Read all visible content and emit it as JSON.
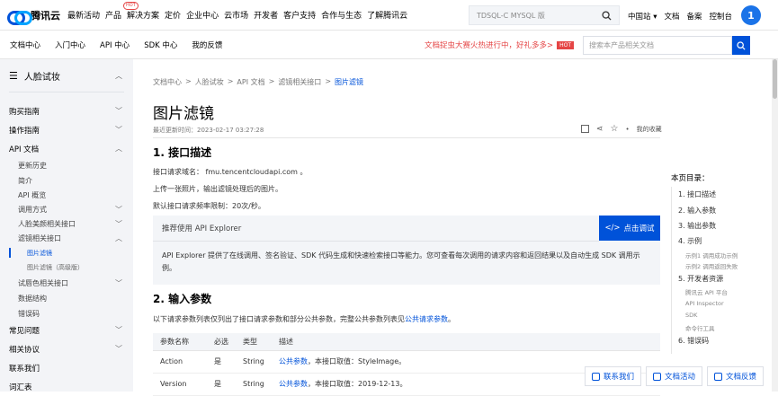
{
  "topbar": {
    "brand": "腾讯云",
    "nav": [
      "最新活动",
      "产品",
      "解决方案",
      "定价",
      "企业中心",
      "云市场",
      "开发者",
      "客户支持",
      "合作与生态",
      "了解腾讯云"
    ],
    "hot_badge": "HOT",
    "search_placeholder": "TDSQL-C MYSQL 版",
    "right_links": [
      "中国站",
      "文档",
      "备案",
      "控制台"
    ],
    "avatar_text": "1"
  },
  "subbar": {
    "links": [
      "文档中心",
      "入门中心",
      "API 中心",
      "SDK 中心",
      "我的反馈"
    ],
    "promo_text": "文档捉虫大赛火热进行中，好礼多多>",
    "promo_badge": "HOT",
    "doc_search_placeholder": "搜索本产品相关文档"
  },
  "sidebar": {
    "product": "人脸试妆",
    "items": [
      {
        "label": "购买指南"
      },
      {
        "label": "操作指南"
      },
      {
        "label": "API 文档"
      },
      {
        "label": "更新历史"
      },
      {
        "label": "简介"
      },
      {
        "label": "API 概览"
      },
      {
        "label": "调用方式"
      },
      {
        "label": "人脸美颜相关接口"
      },
      {
        "label": "滤镜相关接口"
      },
      {
        "label": "图片滤镜"
      },
      {
        "label": "图片滤镜（高级版）"
      },
      {
        "label": "试唇色相关接口"
      },
      {
        "label": "数据结构"
      },
      {
        "label": "错误码"
      },
      {
        "label": "常见问题"
      },
      {
        "label": "相关协议"
      },
      {
        "label": "联系我们"
      },
      {
        "label": "词汇表"
      }
    ]
  },
  "breadcrumb": [
    "文档中心",
    ">",
    "人脸试妆",
    ">",
    "API 文档",
    ">",
    "滤镜相关接口",
    ">",
    "图片滤镜"
  ],
  "page": {
    "title": "图片滤镜",
    "updated": "最近更新时间：2023-02-17 03:27:28",
    "favorite": "我的收藏",
    "h_desc": "1. 接口描述",
    "domain_line": "接口请求域名： fmu.tencentcloudapi.com 。",
    "desc_line": "上传一张照片，输出滤镜处理后的图片。",
    "rate_line": "默认接口请求频率限制：20次/秒。",
    "api_explorer_title": "推荐使用 API Explorer",
    "api_explorer_button": "点击调试",
    "api_explorer_text": "API Explorer 提供了在线调用、签名验证、SDK 代码生成和快速检索接口等能力。您可查看每次调用的请求内容和返回结果以及自动生成 SDK 调用示例。",
    "h_params": "2. 输入参数",
    "params_intro": "以下请求参数列表仅列出了接口请求参数和部分公共参数，完整公共参数列表见",
    "params_link": "公共请求参数",
    "params_intro_end": "。",
    "table": {
      "headers": [
        "参数名称",
        "必选",
        "类型",
        "描述"
      ],
      "rows": [
        {
          "name": "Action",
          "required": "是",
          "type": "String",
          "link": "公共参数",
          "desc": "，本接口取值：StyleImage。"
        },
        {
          "name": "Version",
          "required": "是",
          "type": "String",
          "link": "公共参数",
          "desc": "，本接口取值：2019-12-13。"
        }
      ]
    }
  },
  "toc": {
    "title": "本页目录：",
    "items": [
      "1. 接口描述",
      "2. 输入参数",
      "3. 输出参数",
      "4. 示例",
      "示例1 调用成功示例",
      "示例2 调用返回失败",
      "5. 开发者资源",
      "腾讯云 API 平台",
      "API Inspector",
      "SDK",
      "命令行工具",
      "6. 错误码"
    ]
  },
  "floating": [
    "联系我们",
    "文档活动",
    "文档反馈"
  ],
  "colors": {
    "accent": "#0052d9",
    "promo": "#e54545",
    "sidebar_bg": "#f3f4f7"
  }
}
